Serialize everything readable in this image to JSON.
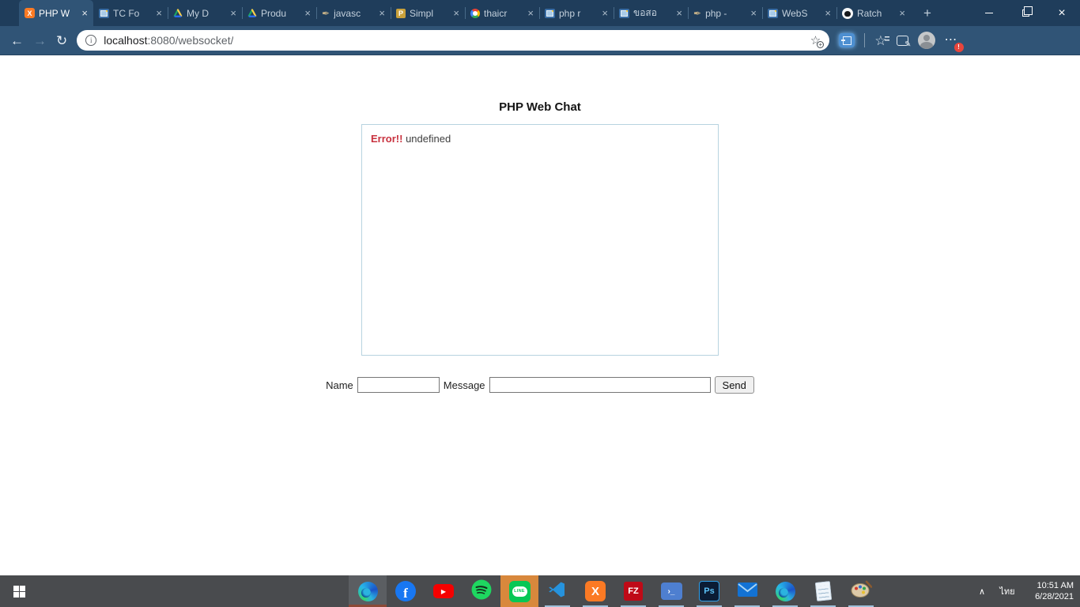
{
  "browser": {
    "tabs": [
      {
        "title": "PHP W"
      },
      {
        "title": "TC Fo"
      },
      {
        "title": "My D"
      },
      {
        "title": "Produ"
      },
      {
        "title": "javasc"
      },
      {
        "title": "Simpl"
      },
      {
        "title": "thaicr"
      },
      {
        "title": "php r"
      },
      {
        "title": "ขอสอ"
      },
      {
        "title": "php -"
      },
      {
        "title": "WebS"
      },
      {
        "title": "Ratch"
      }
    ],
    "address": {
      "host": "localhost",
      "rest": ":8080/websocket/"
    },
    "menu_badge": "!"
  },
  "page": {
    "title": "PHP Web Chat",
    "error_label": "Error!!",
    "error_message": "undefined",
    "name_label": "Name",
    "message_label": "Message",
    "send_label": "Send"
  },
  "taskbar": {
    "apps": [
      "edge",
      "facebook",
      "youtube",
      "spotify",
      "line",
      "vscode",
      "xampp",
      "filezilla",
      "powershell",
      "photoshop",
      "mail",
      "edge",
      "notepad",
      "paint"
    ],
    "tray": {
      "time": "10:51 AM",
      "date": "6/28/2021",
      "language": "ไทย"
    }
  },
  "icons": {
    "back": "←",
    "forward": "→",
    "refresh": "↻",
    "info": "i",
    "close": "×",
    "new_tab": "+",
    "star": "☆",
    "plus": "+",
    "pencil": "✎",
    "menu": "⋯",
    "chevron_up": "∧",
    "play": "▶",
    "facebook": "f",
    "xampp": "X",
    "filezilla": "FZ",
    "powershell": "›_",
    "photoshop": "Ps",
    "packagist": "P",
    "quill": "✒",
    "line": "LINE"
  },
  "colors": {
    "tabstrip": "#1f3d5b",
    "toolbar": "#305476",
    "taskbar": "#494b4e",
    "attention": "#d8883c",
    "error": "#c8313e",
    "chatbox_border": "#b7d3e0"
  }
}
